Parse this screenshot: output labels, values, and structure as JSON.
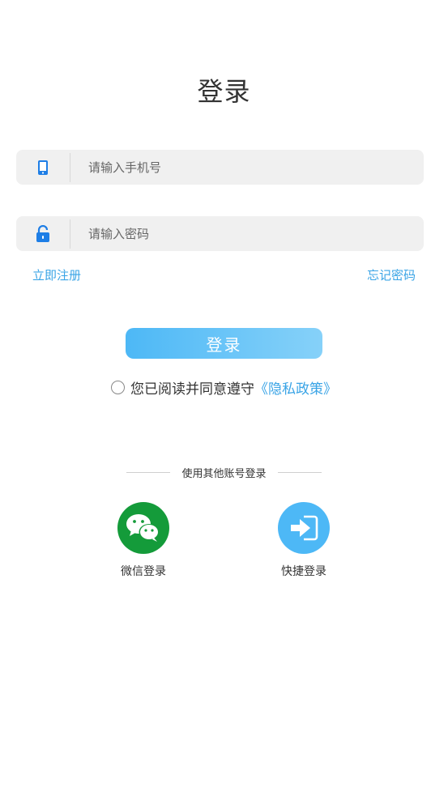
{
  "page": {
    "title": "登录"
  },
  "form": {
    "phone_placeholder": "请输入手机号",
    "phone_icon": "phone-icon",
    "password_placeholder": "请输入密码",
    "password_icon": "lock-icon",
    "register_label": "立即注册",
    "forgot_label": "忘记密码",
    "login_label": "登录"
  },
  "agreement": {
    "text": "您已阅读并同意遵守",
    "policy_label": "《隐私政策》"
  },
  "other_login": {
    "title": "使用其他账号登录",
    "wechat_label": "微信登录",
    "wechat_icon": "wechat-icon",
    "quick_label": "快捷登录",
    "quick_icon": "login-arrow-icon"
  },
  "colors": {
    "accent": "#3aa4e6",
    "button_gradient_start": "#4db8f6",
    "button_gradient_end": "#86d1f9",
    "wechat_green": "#149b3a",
    "field_background": "#f0f0f0"
  }
}
